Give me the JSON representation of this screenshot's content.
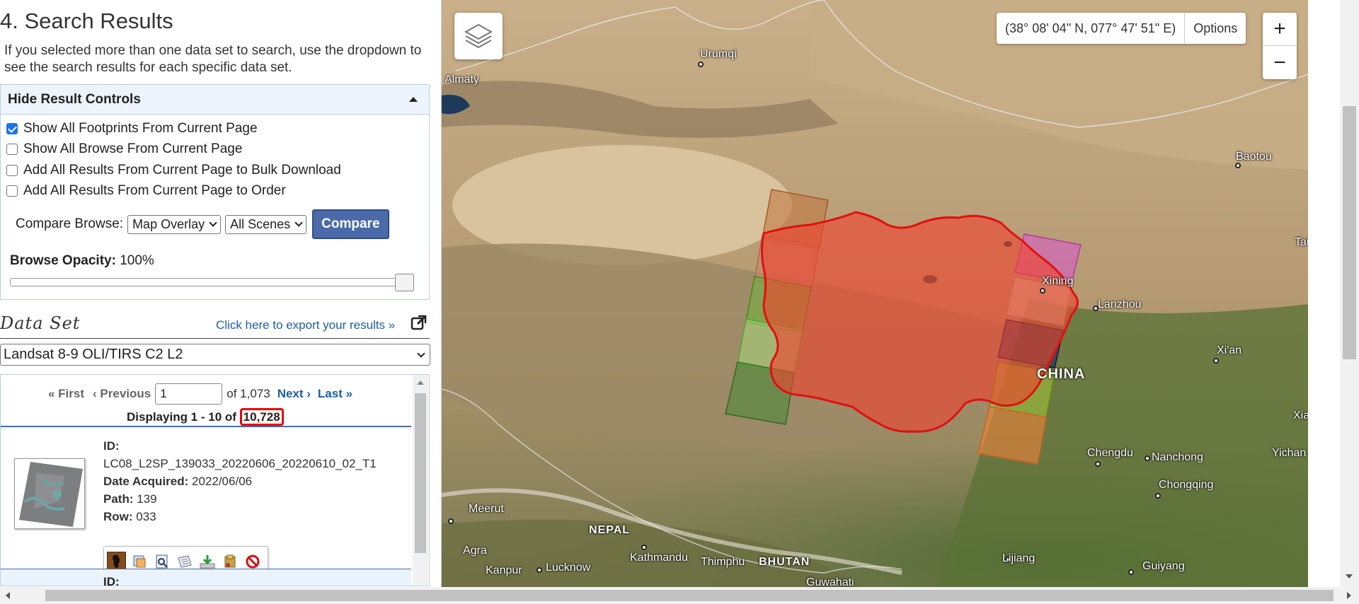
{
  "section": {
    "title": "4. Search Results",
    "intro": "If you selected more than one data set to search, use the dropdown to see the search results for each specific data set."
  },
  "result_controls": {
    "header": "Hide Result Controls",
    "options": [
      {
        "label": "Show All Footprints From Current Page",
        "checked": true
      },
      {
        "label": "Show All Browse From Current Page",
        "checked": false
      },
      {
        "label": "Add All Results From Current Page to Bulk Download",
        "checked": false
      },
      {
        "label": "Add All Results From Current Page to Order",
        "checked": false
      }
    ],
    "compare_label": "Compare Browse:",
    "compare_mode": "Map Overlay",
    "compare_scope": "All Scenes",
    "compare_button": "Compare",
    "opacity_label": "Browse Opacity:",
    "opacity_value": "100%",
    "opacity_fraction": 1.0
  },
  "data_set": {
    "title": "Data Set",
    "export_link": "Click here to export your results »",
    "selected": "Landsat 8-9 OLI/TIRS C2 L2"
  },
  "pager": {
    "first": "« First",
    "previous": "‹ Previous",
    "page": "1",
    "of_text": "of 1,073",
    "next": "Next ›",
    "last": "Last »",
    "displaying_prefix": "Displaying 1 - 10 of",
    "total": "10,728"
  },
  "results": [
    {
      "id_label": "ID:",
      "id": "LC08_L2SP_139033_20220606_20220610_02_T1",
      "date_label": "Date Acquired:",
      "date": "2022/06/06",
      "path_label": "Path:",
      "path": "139",
      "row_label": "Row:",
      "row": "033"
    },
    {
      "id_label": "ID:"
    }
  ],
  "result_actions": [
    "footprint-icon",
    "browse-overlay-icon",
    "show-metadata-icon",
    "compare-icon",
    "download-icon",
    "bulk-download-icon",
    "exclude-icon"
  ],
  "map": {
    "coordinates": "(38° 08' 04\" N, 077° 47' 51\" E)",
    "options_label": "Options",
    "zoom_in": "+",
    "zoom_out": "−",
    "labels": {
      "urumqi": "Urumqi",
      "almaty": "Almaty",
      "baotou": "Baotou",
      "tai": "Tai",
      "xining": "Xining",
      "lanzhou": "Lanzhou",
      "xian": "Xi'an",
      "china": "CHINA",
      "xia": "Xia",
      "chengdu": "Chengdu",
      "nanchong": "Nanchong",
      "yichang": "Yichan",
      "chongqing": "Chongqing",
      "meerut": "Meerut",
      "nepal": "NEPAL",
      "kathmandu": "Kathmandu",
      "thimphu": "Thimphu",
      "bhutan": "BHUTAN",
      "lijiang": "Lijiang",
      "agra": "Agra",
      "kanpur": "Kanpur",
      "lucknow": "Lucknow",
      "guwahati": "Guwahati",
      "guiyang": "Guiyang"
    }
  }
}
